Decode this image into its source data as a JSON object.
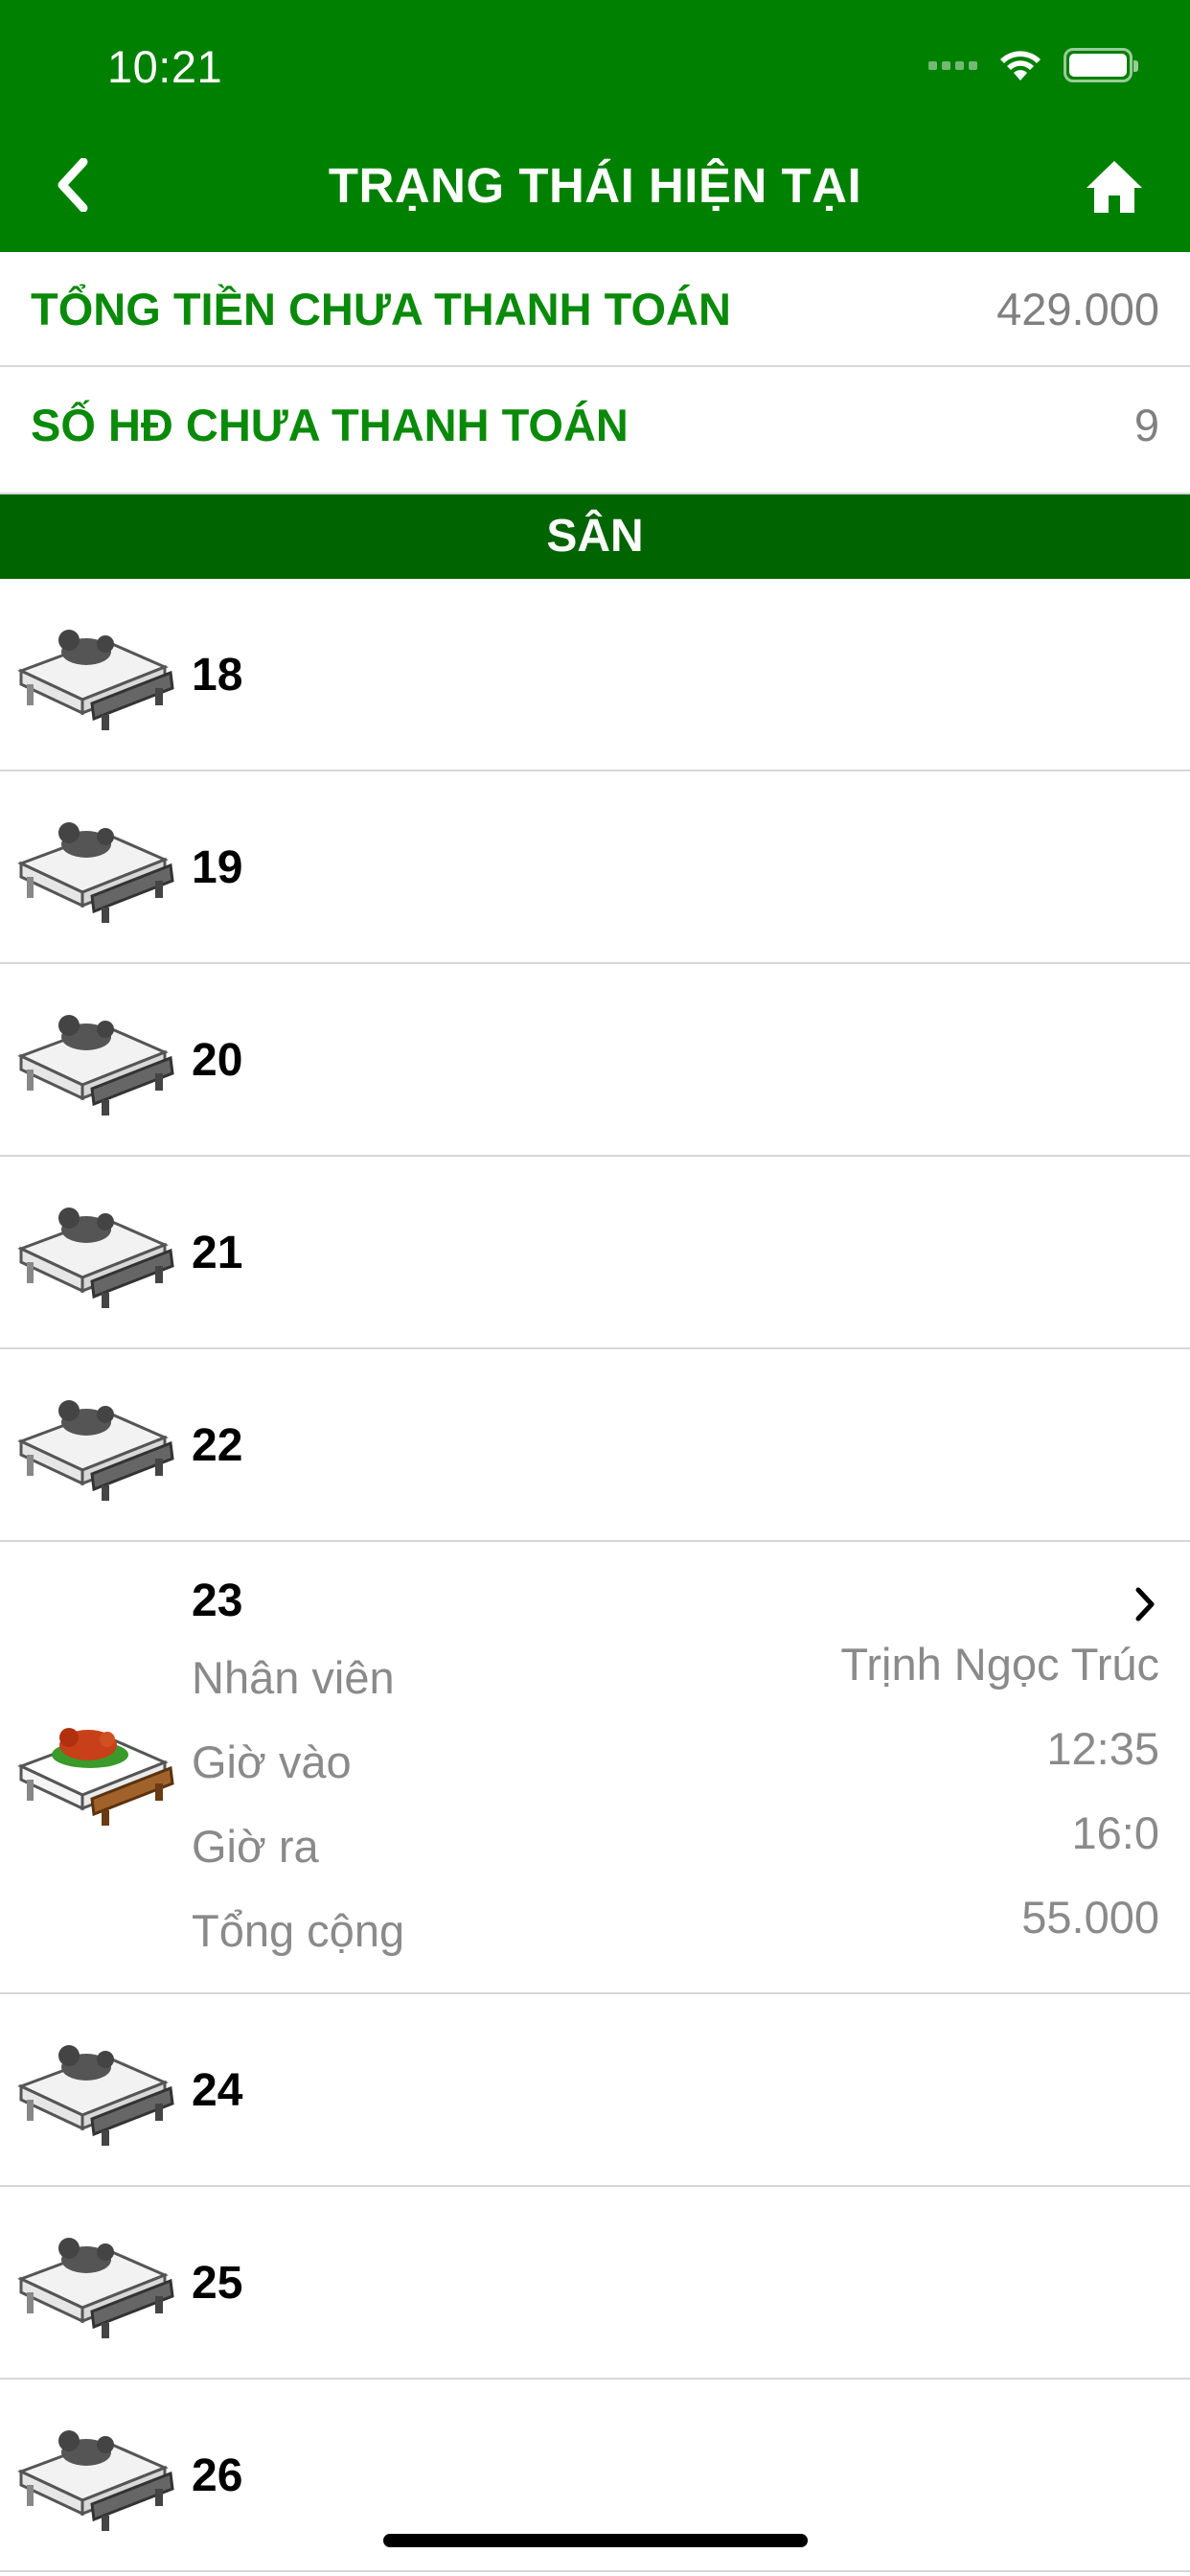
{
  "status_bar": {
    "time": "10:21"
  },
  "nav": {
    "title": "TRẠNG THÁI HIỆN TẠI",
    "back_icon": "chevron-left-icon",
    "home_icon": "home-icon"
  },
  "summary": {
    "total_unpaid_label": "TỔNG TIỀN CHƯA THANH TOÁN",
    "total_unpaid_value": "429.000",
    "unpaid_invoices_label": "SỐ HĐ CHƯA THANH TOÁN",
    "unpaid_invoices_value": "9"
  },
  "section": {
    "title": "SÂN"
  },
  "tables": [
    {
      "name": "18",
      "occupied": false
    },
    {
      "name": "19",
      "occupied": false
    },
    {
      "name": "20",
      "occupied": false
    },
    {
      "name": "21",
      "occupied": false
    },
    {
      "name": "22",
      "occupied": false
    },
    {
      "name": "23",
      "occupied": true,
      "details": [
        {
          "label": "Nhân viên",
          "value": "Trịnh Ngọc Trúc"
        },
        {
          "label": "Giờ vào",
          "value": "12:35"
        },
        {
          "label": "Giờ ra",
          "value": "16:0"
        },
        {
          "label": "Tổng cộng",
          "value": "55.000"
        }
      ]
    },
    {
      "name": "24",
      "occupied": false
    },
    {
      "name": "25",
      "occupied": false
    },
    {
      "name": "26",
      "occupied": false
    }
  ],
  "colors": {
    "header_green": "#008000",
    "section_green": "#006400",
    "label_green": "#0a8a0a",
    "muted_gray": "#8a8a8a"
  }
}
